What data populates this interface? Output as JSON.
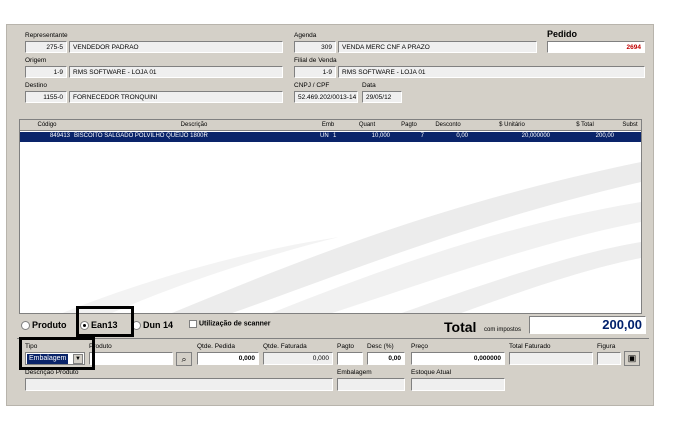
{
  "header": {
    "representante_label": "Representante",
    "representante_code": "275-5",
    "representante_name": "VENDEDOR PADRAO",
    "agenda_label": "Agenda",
    "agenda_code": "309",
    "agenda_name": "VENDA MERC CNF A PRAZO",
    "pedido_label": "Pedido",
    "pedido_value": "2694",
    "origem_label": "Origem",
    "origem_code": "1-9",
    "origem_name": "RMS SOFTWARE - LOJA 01",
    "filial_label": "Filial de Venda",
    "filial_code": "1-9",
    "filial_name": "RMS SOFTWARE - LOJA 01",
    "destino_label": "Destino",
    "destino_code": "1155-0",
    "destino_name": "FORNECEDOR TRONQUINI",
    "cnpj_label": "CNPJ / CPF",
    "cnpj_value": "52.469.202/0013-14",
    "data_label": "Data",
    "data_value": "29/05/12"
  },
  "grid": {
    "columns": [
      "Código",
      "Descrição",
      "Emb",
      "Quant",
      "Pagto",
      "Desconto",
      "$ Unitário",
      "$ Total",
      "Subst"
    ],
    "rows": [
      {
        "codigo": "849413",
        "descricao": "BISCOITO SALGADO POLVILHO QUEIJO 1800R",
        "emb": "UN",
        "emb_qty": "1",
        "quant": "10,000",
        "pagto": "7",
        "desconto": "0,00",
        "unitario": "20,000000",
        "total": "200,00",
        "subst": ""
      }
    ]
  },
  "search_mode": {
    "produto_label": "Produto",
    "ean13_label": "Ean13",
    "dun14_label": "Dun 14",
    "scanner_label": "Utilização de scanner",
    "selected": "Ean13"
  },
  "total": {
    "label": "Total",
    "sublabel": "com impostos",
    "value": "200,00"
  },
  "entry": {
    "tipo_label": "Tipo",
    "tipo_value": "Embalagem",
    "produto_label": "Produto",
    "qtde_pedida_label": "Qtde. Pedida",
    "qtde_pedida_value": "0,000",
    "qtde_faturada_label": "Qtde. Faturada",
    "qtde_faturada_value": "0,000",
    "pagto_label": "Pagto",
    "desc_label": "Desc (%)",
    "desc_value": "0,00",
    "preco_label": "Preço",
    "preco_value": "0,000000",
    "total_faturado_label": "Total Faturado",
    "figura_label": "Figura",
    "descricao_label": "Descrição Produto",
    "embalagem_label": "Embalagem",
    "estoque_label": "Estoque Atual"
  },
  "colors": {
    "selection": "#0a246a",
    "pedido_red": "#c00000",
    "total_navy": "#00206b"
  }
}
